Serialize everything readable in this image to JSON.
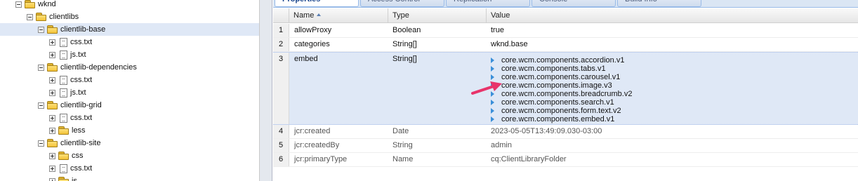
{
  "tree": {
    "items": [
      {
        "label": "wknd",
        "toggle": "minus",
        "icon": "folder-icon"
      },
      {
        "label": "clientlibs",
        "toggle": "minus",
        "icon": "folder-icon"
      },
      {
        "label": "clientlib-base",
        "toggle": "minus",
        "icon": "folder-icon"
      },
      {
        "label": "css.txt",
        "toggle": "plus",
        "icon": "file-icon"
      },
      {
        "label": "js.txt",
        "toggle": "plus",
        "icon": "file-icon"
      },
      {
        "label": "clientlib-dependencies",
        "toggle": "minus",
        "icon": "folder-icon"
      },
      {
        "label": "css.txt",
        "toggle": "plus",
        "icon": "file-icon"
      },
      {
        "label": "js.txt",
        "toggle": "plus",
        "icon": "file-icon"
      },
      {
        "label": "clientlib-grid",
        "toggle": "minus",
        "icon": "folder-icon"
      },
      {
        "label": "css.txt",
        "toggle": "plus",
        "icon": "file-icon"
      },
      {
        "label": "less",
        "toggle": "plus",
        "icon": "folder-icon"
      },
      {
        "label": "clientlib-site",
        "toggle": "minus",
        "icon": "folder-icon"
      },
      {
        "label": "css",
        "toggle": "plus",
        "icon": "folder-icon"
      },
      {
        "label": "css.txt",
        "toggle": "plus",
        "icon": "file-icon"
      },
      {
        "label": "js",
        "toggle": "plus",
        "icon": "folder-icon"
      }
    ]
  },
  "tabs": [
    {
      "label": "Properties",
      "active": true
    },
    {
      "label": "Access Control"
    },
    {
      "label": "Replication"
    },
    {
      "label": "Console"
    },
    {
      "label": "Build Info"
    }
  ],
  "grid": {
    "columns": {
      "name": "Name",
      "type": "Type",
      "value": "Value"
    },
    "rows": [
      {
        "num": "1",
        "name": "allowProxy",
        "type": "Boolean",
        "value": "true"
      },
      {
        "num": "2",
        "name": "categories",
        "type": "String[]",
        "value": "wknd.base"
      },
      {
        "num": "3",
        "name": "embed",
        "type": "String[]",
        "values": [
          "core.wcm.components.accordion.v1",
          "core.wcm.components.tabs.v1",
          "core.wcm.components.carousel.v1",
          "core.wcm.components.image.v3",
          "core.wcm.components.breadcrumb.v2",
          "core.wcm.components.search.v1",
          "core.wcm.components.form.text.v2",
          "core.wcm.components.embed.v1"
        ]
      },
      {
        "num": "4",
        "name": "jcr:created",
        "type": "Date",
        "value": "2023-05-05T13:49:09.030-03:00"
      },
      {
        "num": "5",
        "name": "jcr:createdBy",
        "type": "String",
        "value": "admin"
      },
      {
        "num": "6",
        "name": "jcr:primaryType",
        "type": "Name",
        "value": "cq:ClientLibraryFolder"
      }
    ]
  },
  "colors": {
    "selection": "#dfe8f6",
    "arrow": "#e8336a",
    "tree_triangle": "#3a8fd9"
  }
}
